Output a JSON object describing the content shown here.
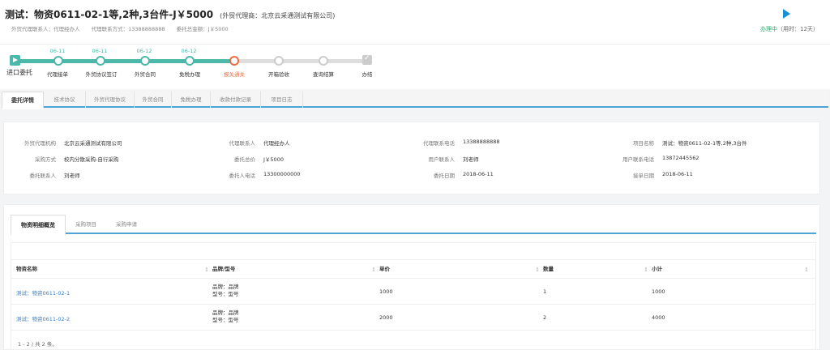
{
  "header": {
    "title": "测试：物资0611-02-1等,2种,3台件-J￥5000",
    "subtitle": "(外贸代理商：北京云采通测试有限公司)",
    "meta": [
      "外贸代理联系人：代理经办人",
      "代理联系方式：13388888888",
      "委托总金额：J￥5000"
    ],
    "status": "办理中",
    "used": "（用时：12天）",
    "play_icon": "play-icon"
  },
  "progress": {
    "steps": [
      {
        "label": "进口委托",
        "date": ""
      },
      {
        "label": "代理接单",
        "date": "06-11"
      },
      {
        "label": "外贸协议签订",
        "date": "06-11"
      },
      {
        "label": "外贸合同",
        "date": "06-12"
      },
      {
        "label": "免税办理",
        "date": "06-12"
      },
      {
        "label": "报关通关",
        "date": ""
      },
      {
        "label": "开箱验收",
        "date": ""
      },
      {
        "label": "查询结算",
        "date": ""
      },
      {
        "label": "办结",
        "date": ""
      }
    ]
  },
  "tabs": [
    "委托详情",
    "技术协议",
    "外贸代理协议",
    "外贸合同",
    "免税办理",
    "收款付款记录",
    "项目日志"
  ],
  "details": {
    "agent_org_label": "外贸代理机构",
    "agent_org": "北京云采通测试有限公司",
    "purchase_method_label": "采购方式",
    "purchase_method": "校内分散采购-自行采购",
    "client_contact_label": "委托联系人",
    "client_contact": "刘老师",
    "agent_contact_label": "代理联系人",
    "agent_contact": "代理经办人",
    "total_label": "委托总价",
    "total": "J￥5000",
    "client_phone_label": "委托人电话",
    "client_phone": "13300000000",
    "agent_phone_label": "代理联系电话",
    "agent_phone": "13388888888",
    "user_contact_label": "用户联系人",
    "user_contact": "刘老师",
    "client_date_label": "委托日期",
    "client_date": "2018-06-11",
    "project_name_label": "项目名称",
    "project_name": "测试：物资0611-02-1等,2种,3台件",
    "user_phone_label": "用户联系电话",
    "user_phone": "13872445562",
    "accept_date_label": "接单日期",
    "accept_date": "2018-06-11"
  },
  "inner_tabs": [
    "物资明细概览",
    "采购项目",
    "采购申请"
  ],
  "table": {
    "headers": [
      "物资名称",
      "品牌/型号",
      "单价",
      "数量",
      "小计"
    ],
    "rows": [
      {
        "name": "测试：物资0611-02-1",
        "brand": "品牌：品牌",
        "model": "型号：型号",
        "price": "1000",
        "qty": "1",
        "subtotal": "1000"
      },
      {
        "name": "测试：物资0611-02-2",
        "brand": "品牌：品牌",
        "model": "型号：型号",
        "price": "2000",
        "qty": "2",
        "subtotal": "4000"
      }
    ],
    "pager": "1 - 2 / 共 2 条。"
  }
}
